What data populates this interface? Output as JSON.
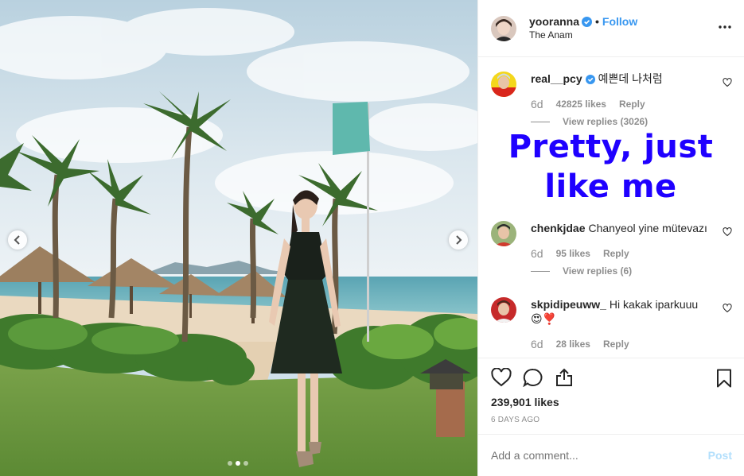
{
  "header": {
    "username": "yooranna",
    "separator": "•",
    "follow_label": "Follow",
    "location": "The Anam"
  },
  "comments": [
    {
      "username": "real__pcy",
      "verified": true,
      "text": "예쁜데 나처럼",
      "time": "6d",
      "likes": "42825 likes",
      "reply": "Reply",
      "view_replies": "View replies (3026)"
    },
    {
      "username": "chenkjdae",
      "verified": false,
      "text": "Chanyeol yine mütevazı",
      "time": "6d",
      "likes": "95 likes",
      "reply": "Reply",
      "view_replies": "View replies (6)"
    },
    {
      "username": "skpidipeuww_",
      "verified": false,
      "text": "Hi kakak iparkuuu",
      "emoji": "😍❣️",
      "time": "6d",
      "likes": "28 likes",
      "reply": "Reply"
    }
  ],
  "overlay": {
    "line1": "Pretty, just",
    "line2": "like me",
    "color": "#1f00ff"
  },
  "footer": {
    "likes": "239,901 likes",
    "ago": "6 DAYS AGO",
    "add_comment_placeholder": "Add a comment...",
    "post_label": "Post"
  },
  "carousel": {
    "slide_count": 3,
    "active_index": 1
  },
  "colors": {
    "accent": "#3897f0",
    "muted": "#8e8e8e",
    "post_disabled": "#b2dffc"
  },
  "icons": [
    "chevron-left-icon",
    "chevron-right-icon",
    "verified-badge-icon",
    "more-options-icon",
    "heart-icon",
    "comment-icon",
    "share-icon",
    "bookmark-icon"
  ]
}
